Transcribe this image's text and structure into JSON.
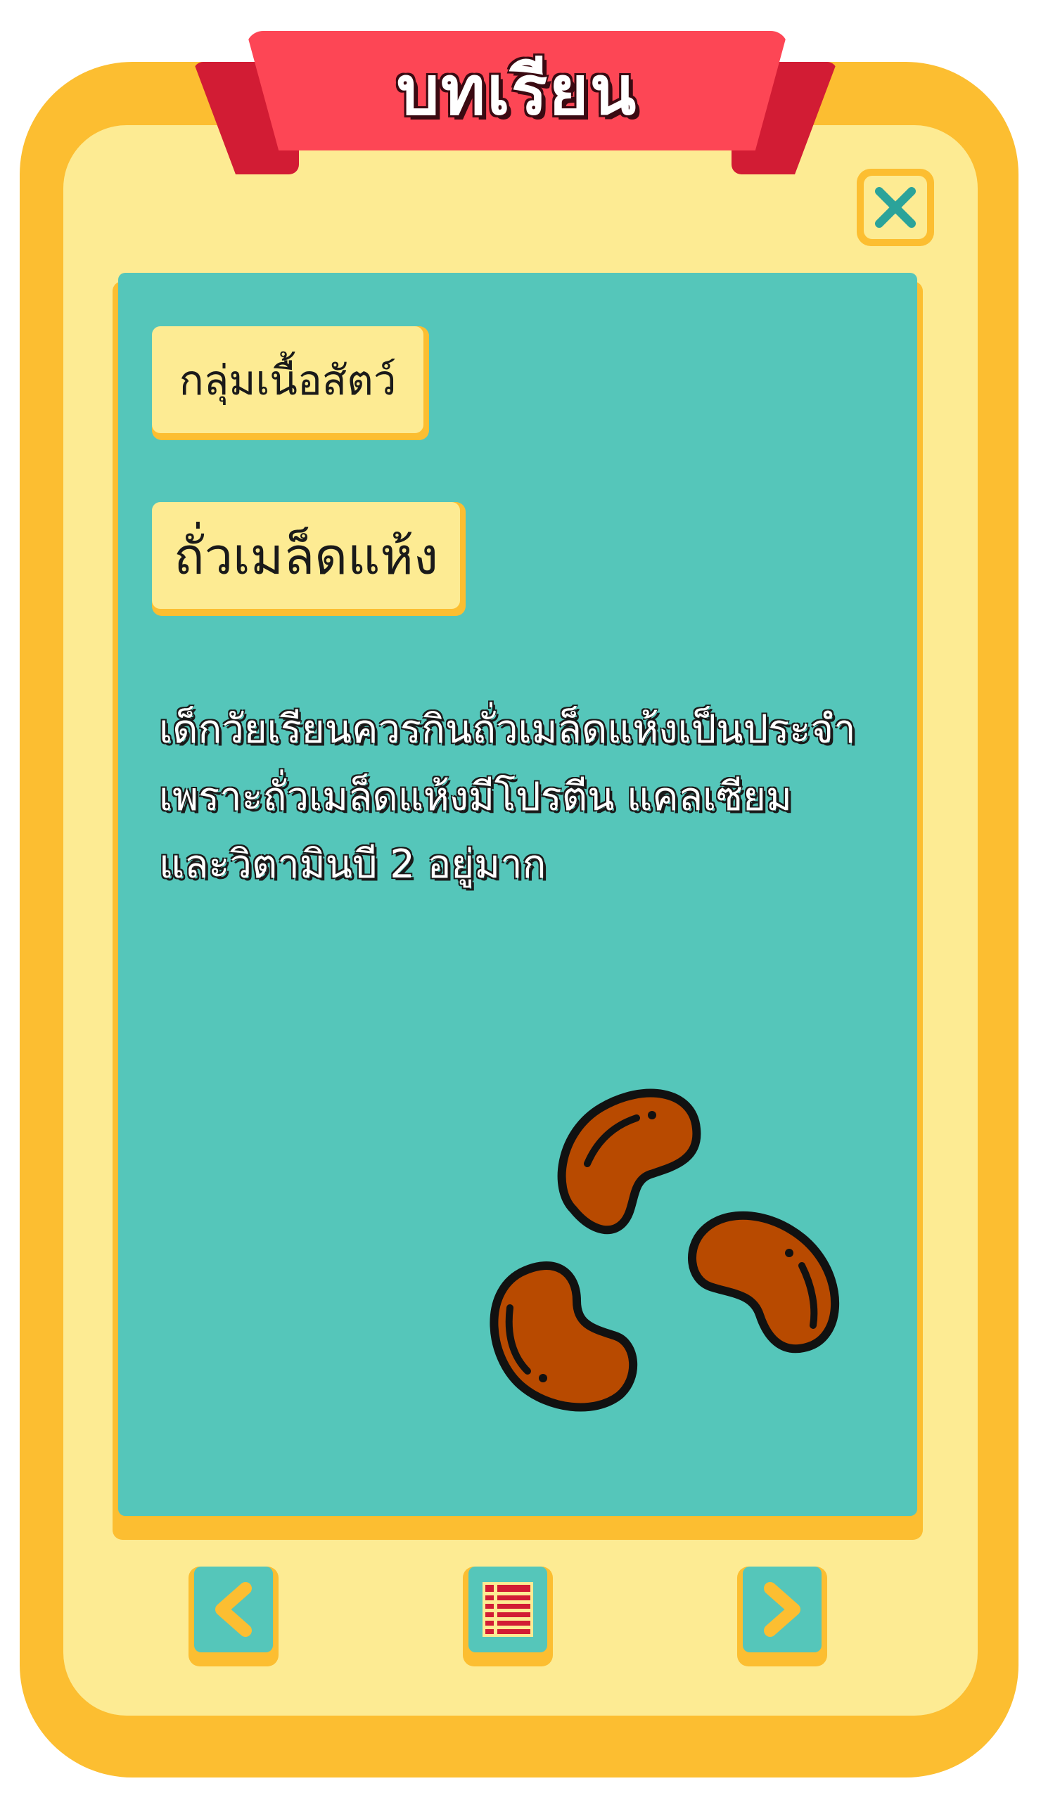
{
  "window": {
    "title": "บทเรียน"
  },
  "lesson": {
    "category": "กลุ่มเนื้อสัตว์",
    "topic": "ถั่วเมล็ดแห้ง",
    "description_lines": [
      "เด็กวัยเรียนควรกินถั่วเมล็ดแห้งเป็นประจำ",
      "เพราะถั่วเมล็ดแห้งมีโปรตีน แคลเซียม",
      "และวิตามินบี 2 อยู่มาก"
    ],
    "illustration_icon": "kidney-beans-icon"
  },
  "controls": {
    "close_icon": "close-icon",
    "prev_icon": "chevron-left-icon",
    "menu_icon": "list-icon",
    "next_icon": "chevron-right-icon"
  },
  "colors": {
    "frame_outer": "#FCBE31",
    "frame_inner": "#FDEB93",
    "ribbon": "#FD4655",
    "ribbon_tail": "#D21C34",
    "panel": "#55C6BA",
    "bean": "#B84A00"
  }
}
